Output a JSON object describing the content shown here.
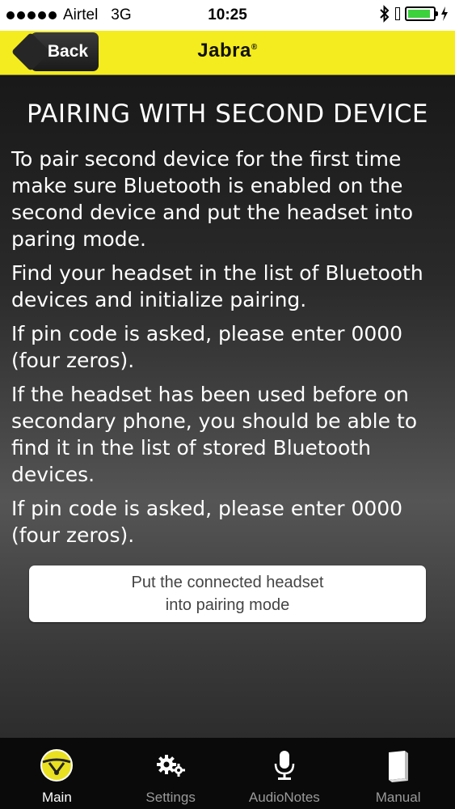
{
  "status_bar": {
    "carrier": "Airtel",
    "network": "3G",
    "time": "10:25",
    "signal_bars": 5,
    "battery_level": 0.9,
    "battery_color": "#3cd23c"
  },
  "nav": {
    "back_label": "Back",
    "logo": "Jabra",
    "logo_mark": "®",
    "bar_color": "#f4ec1e"
  },
  "main": {
    "title": "PAIRING WITH SECOND DEVICE",
    "paragraphs": [
      "To pair second device for the first time make sure Bluetooth is enabled on the second device and put the headset into paring mode.",
      "Find your headset in the list of Bluetooth devices and initialize pairing.",
      "If pin code is asked, please enter 0000 (four zeros).",
      "If the headset has been used before on secondary phone, you should be able to find it in the list of stored Bluetooth devices.",
      "If pin code is asked, please enter 0000 (four zeros)."
    ],
    "action_button": {
      "line1": "Put the connected headset",
      "line2": "into pairing mode"
    }
  },
  "tabs": [
    {
      "label": "Main",
      "icon": "headset-circle-icon",
      "active": true
    },
    {
      "label": "Settings",
      "icon": "gears-icon",
      "active": false
    },
    {
      "label": "AudioNotes",
      "icon": "microphone-icon",
      "active": false
    },
    {
      "label": "Manual",
      "icon": "book-icon",
      "active": false
    }
  ]
}
